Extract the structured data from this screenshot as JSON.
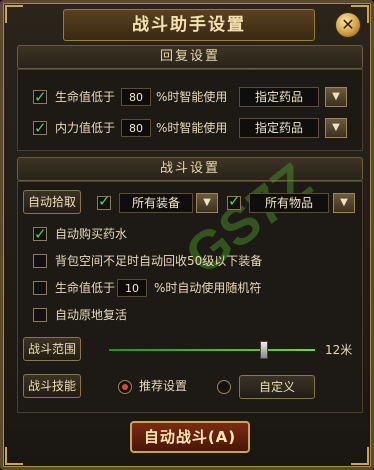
{
  "window": {
    "title": "战斗助手设置",
    "close_glyph": "✕"
  },
  "sections": {
    "recovery": "回复设置",
    "combat": "战斗设置"
  },
  "recovery": {
    "hp": {
      "checked": true,
      "label_prefix": "生命值低于",
      "value": "80",
      "label_suffix": "%时智能使用",
      "select": "指定药品"
    },
    "mp": {
      "checked": true,
      "label_prefix": "内力值低于",
      "value": "80",
      "label_suffix": "%时智能使用",
      "select": "指定药品"
    }
  },
  "combat": {
    "auto_pickup": {
      "button": "自动拾取",
      "equip_checked": true,
      "equip_select": "所有装备",
      "items_checked": true,
      "items_select": "所有物品"
    },
    "auto_buy": {
      "checked": true,
      "label": "自动购买药水"
    },
    "recycle": {
      "checked": false,
      "label": "背包空间不足时自动回收50级以下装备"
    },
    "random_scroll": {
      "checked": false,
      "label_prefix": "生命值低于",
      "value": "10",
      "label_suffix": "%时自动使用随机符"
    },
    "revive": {
      "checked": false,
      "label": "自动原地复活"
    },
    "range": {
      "button": "战斗范围",
      "value_label": "12米",
      "fraction": 0.75
    },
    "skills": {
      "button": "战斗技能",
      "recommended": "推荐设置",
      "custom": "自定义",
      "selected": "recommended"
    }
  },
  "auto_fight_button": "自动战斗(A)",
  "watermark": "GS7Z.com",
  "colors": {
    "accent": "#c9a55a",
    "check": "#5bd13a",
    "radio": "#d34a2e"
  }
}
